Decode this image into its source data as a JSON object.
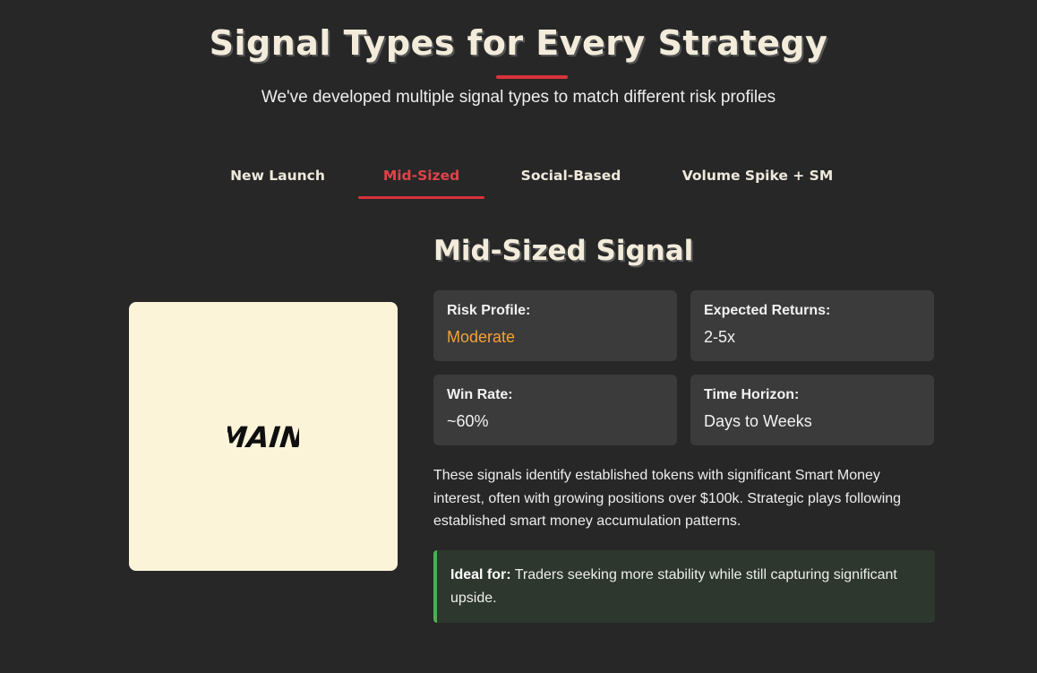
{
  "section": {
    "heading": "Signal Types for Every Strategy",
    "subtitle": "We've developed multiple signal types to match different risk profiles"
  },
  "tabs": [
    {
      "label": "New Launch",
      "active": false
    },
    {
      "label": "Mid-Sized",
      "active": true
    },
    {
      "label": "Social-Based",
      "active": false
    },
    {
      "label": "Volume Spike + SM",
      "active": false
    }
  ],
  "image": {
    "text": "MAIN",
    "background": "#fcf4d9"
  },
  "signal": {
    "title": "Mid-Sized Signal",
    "stats": {
      "risk": {
        "label": "Risk Profile:",
        "value": "Moderate"
      },
      "returns": {
        "label": "Expected Returns:",
        "value": "2-5x"
      },
      "win_rate": {
        "label": "Win Rate:",
        "value": "~60%"
      },
      "horizon": {
        "label": "Time Horizon:",
        "value": "Days to Weeks"
      }
    },
    "description": "These signals identify established tokens with significant Smart Money interest, often with growing positions over $100k. Strategic plays following established smart money accumulation patterns.",
    "ideal_label": "Ideal for:",
    "ideal_text": " Traders seeking more stability while still capturing significant upside."
  },
  "colors": {
    "background": "#272727",
    "accent_red": "#d8333c",
    "risk_orange": "#f4a234",
    "ideal_green": "#4caf50",
    "card": "#3b3b3b"
  }
}
